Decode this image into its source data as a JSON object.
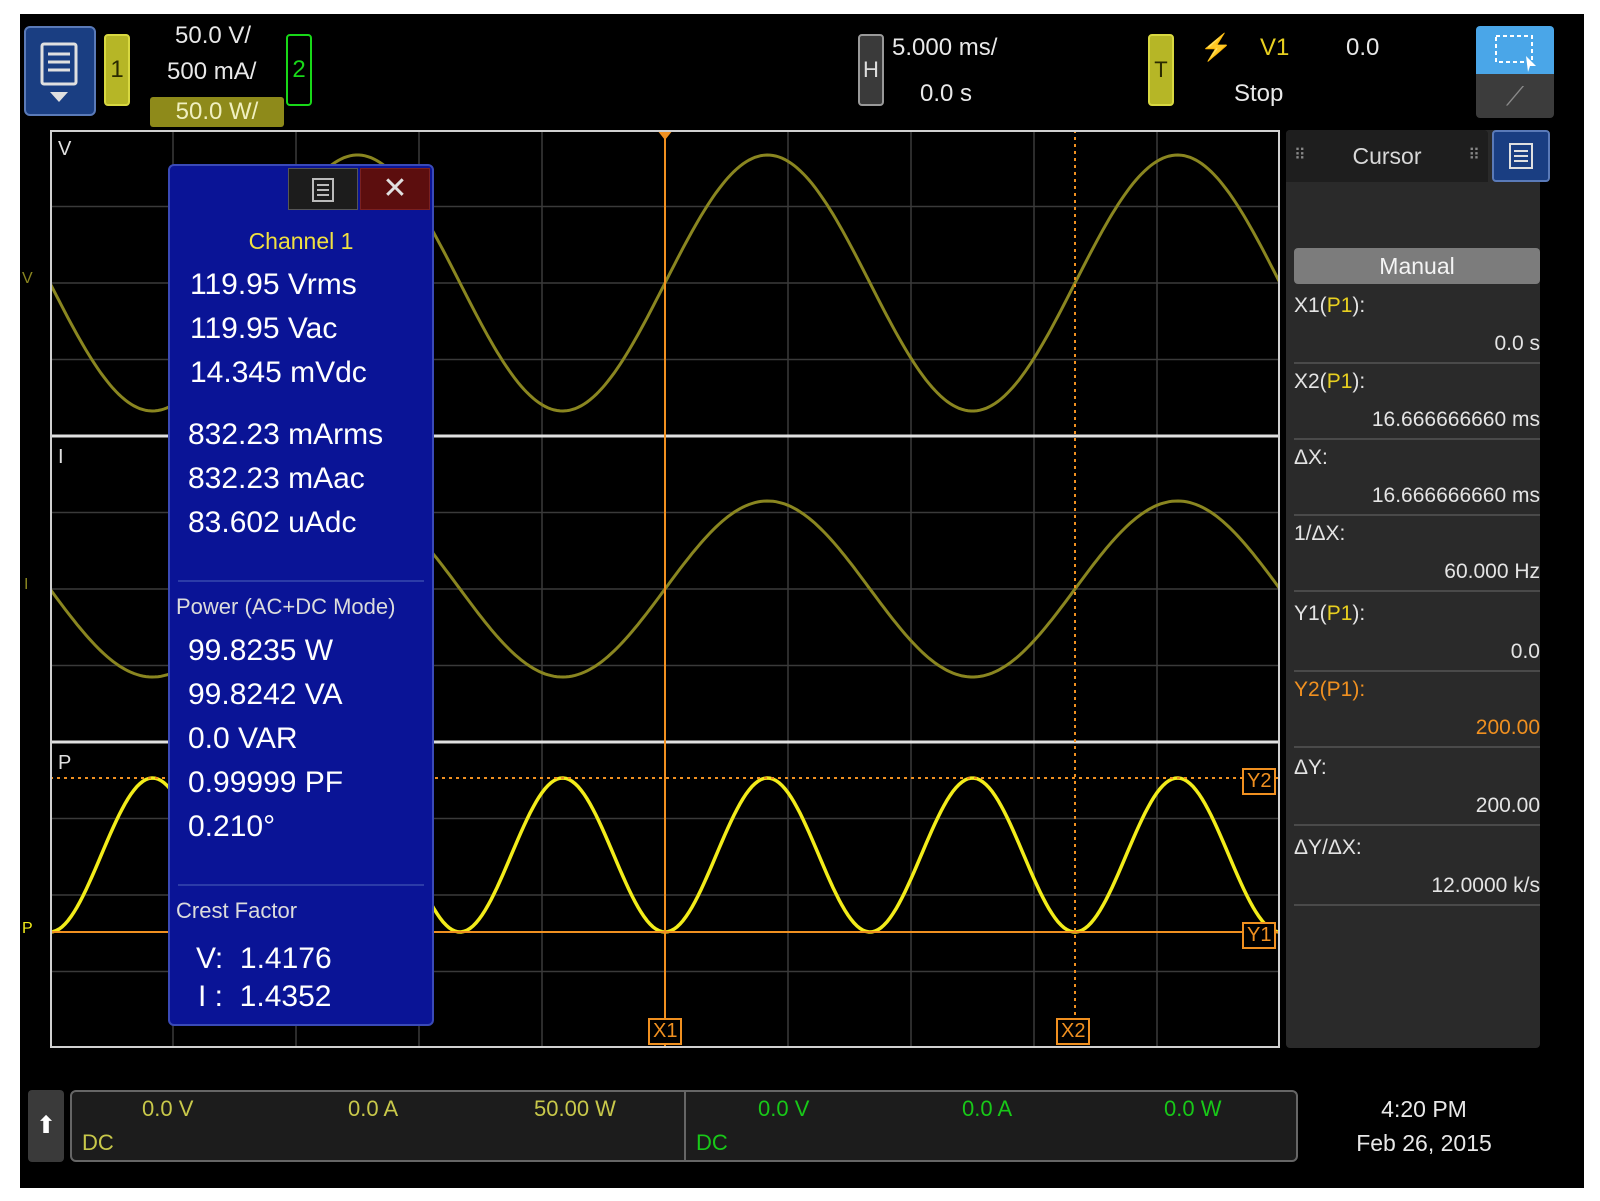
{
  "header": {
    "ch1_label": "1",
    "ch2_label": "2",
    "ch1_scale": "50.0 V/",
    "ch2_scale": "500 mA/",
    "math_scale": "50.0 W/",
    "h_label": "H",
    "timebase": "5.000 ms/",
    "delay": "0.0 s",
    "t_label": "T",
    "trigger_icon": "trigger-rising-edge-icon",
    "trigger_source": "V1",
    "trigger_level": "0.0",
    "run_state": "Stop"
  },
  "traces": {
    "v_label": "V",
    "i_label": "I",
    "p_label": "P",
    "v_ground": "V",
    "i_ground": "I",
    "p_ground": "P",
    "trace_color_dim": "#8a8620",
    "trace_color_bright": "#f2ec1a",
    "cursor_color": "#f09020"
  },
  "cursor_markers": {
    "x1": "X1",
    "x2": "X2",
    "y1": "Y1",
    "y2": "Y2"
  },
  "measurement_popup": {
    "title": "Channel 1",
    "voltage": [
      "119.95 Vrms",
      "119.95 Vac",
      "14.345 mVdc"
    ],
    "current": [
      "832.23 mArms",
      "832.23 mAac",
      "83.602 uAdc"
    ],
    "power_heading": "Power (AC+DC Mode)",
    "power": [
      "99.8235 W",
      "99.8242 VA",
      "0.0 VAR",
      "0.99999 PF",
      "0.210°"
    ],
    "crest_heading": "Crest Factor",
    "crest_v": "V:  1.4176",
    "crest_i": "I :  1.4352"
  },
  "cursor_panel": {
    "tab_label": "Cursor",
    "mode": "Manual",
    "x1_label": "X1(",
    "x1_src": "P1",
    "x1_value": "0.0 s",
    "x2_label": "X2(",
    "x2_src": "P1",
    "x2_value": "16.666666660 ms",
    "dx_label": "ΔX:",
    "dx_value": "16.666666660 ms",
    "inv_dx_label": "1/ΔX:",
    "inv_dx_value": "60.000 Hz",
    "y1_label": "Y1(",
    "y1_src": "P1",
    "y1_value": "0.0",
    "y2_label": "Y2(P1):",
    "y2_value": "200.00",
    "dy_label": "ΔY:",
    "dy_value": "200.00",
    "dydx_label": "ΔY/ΔX:",
    "dydx_value": "12.0000 k/s",
    "close_paren": "):"
  },
  "bottom_bar": {
    "left": [
      "0.0 V",
      "0.0 A",
      "50.00 W"
    ],
    "left_coupling": "DC",
    "right": [
      "0.0 V",
      "0.0 A",
      "0.0 W"
    ],
    "right_coupling": "DC",
    "time": "4:20 PM",
    "date": "Feb 26, 2015"
  }
}
